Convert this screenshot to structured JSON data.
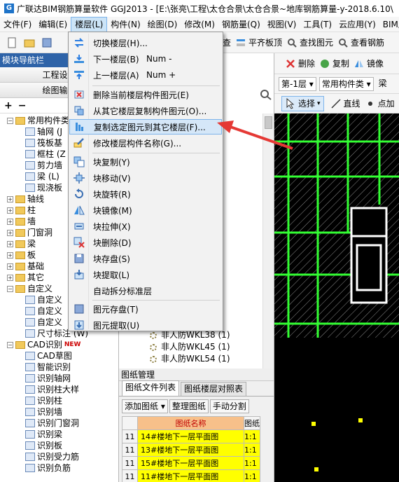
{
  "window": {
    "title": "广联达BIM钢筋算量软件 GGJ2013 - [E:\\张亮\\工程\\太仓合景\\太仓合景~地库钢筋算量-y-2018.6.10\\"
  },
  "menubar": {
    "items": [
      "文件(F)",
      "编辑(E)",
      "楼层(L)",
      "构件(N)",
      "绘图(D)",
      "修改(M)",
      "钢筋量(Q)",
      "视图(V)",
      "工具(T)",
      "云应用(Y)",
      "BIM应"
    ]
  },
  "toolbar": {
    "items": [
      "齐检查",
      "平齐板顶",
      "查找图元",
      "查看钢筋"
    ]
  },
  "leftpanel": {
    "header": "模块导航栏",
    "btn_settings": "工程设置",
    "btn_drawing": "绘图输入",
    "tree": [
      {
        "label": "常用构件类",
        "level": 0,
        "expanded": true
      },
      {
        "label": "轴网 (J",
        "level": 1
      },
      {
        "label": "筏板基",
        "level": 1
      },
      {
        "label": "框柱 (Z",
        "level": 1
      },
      {
        "label": "剪力墙",
        "level": 1
      },
      {
        "label": "梁 (L)",
        "level": 1
      },
      {
        "label": "现浇板",
        "level": 1
      },
      {
        "label": "轴线",
        "level": 0
      },
      {
        "label": "柱",
        "level": 0
      },
      {
        "label": "墙",
        "level": 0
      },
      {
        "label": "门窗洞",
        "level": 0
      },
      {
        "label": "梁",
        "level": 0
      },
      {
        "label": "板",
        "level": 0
      },
      {
        "label": "基础",
        "level": 0
      },
      {
        "label": "其它",
        "level": 0
      },
      {
        "label": "自定义",
        "level": 0,
        "expanded": true
      },
      {
        "label": "自定义",
        "level": 1
      },
      {
        "label": "自定义",
        "level": 1
      },
      {
        "label": "自定义",
        "level": 1
      },
      {
        "label": "尺寸标注 (W)",
        "level": 1
      },
      {
        "label": "CAD识别",
        "level": 0,
        "expanded": true,
        "badge": "NEW"
      },
      {
        "label": "CAD草图",
        "level": 1
      },
      {
        "label": "智能识别",
        "level": 1
      },
      {
        "label": "识别轴网",
        "level": 1
      },
      {
        "label": "识别柱大样",
        "level": 1
      },
      {
        "label": "识别柱",
        "level": 1
      },
      {
        "label": "识别墙",
        "level": 1
      },
      {
        "label": "识别门窗洞",
        "level": 1
      },
      {
        "label": "识别梁",
        "level": 1
      },
      {
        "label": "识别板",
        "level": 1
      },
      {
        "label": "识别受力筋",
        "level": 1
      },
      {
        "label": "识别负筋",
        "level": 1
      }
    ]
  },
  "midpanel": {
    "items": [
      "非人防WKL38 (1)",
      "非人防WKL45 (1)",
      "非人防WKL54 (1)"
    ]
  },
  "drawing_panel": {
    "title": "图纸管理",
    "tabs": [
      "图纸文件列表",
      "图纸楼层对照表"
    ],
    "actions": [
      "添加图纸",
      "整理图纸",
      "手动分割"
    ],
    "col_name": "图纸名称",
    "col_scale": "图纸",
    "rows": [
      {
        "num": "11",
        "name": "14#楼地下一层平面图",
        "scale": "1:1"
      },
      {
        "num": "11",
        "name": "13#楼地下一层平面图",
        "scale": "1:1"
      },
      {
        "num": "11",
        "name": "15#楼地下一层平面图",
        "scale": "1:1"
      },
      {
        "num": "11",
        "name": "11#楼地下一层平面图",
        "scale": "1:1"
      }
    ]
  },
  "right_toolbar": {
    "delete": "删除",
    "copy": "复制",
    "mirror": "镜像",
    "floor": "第-1层",
    "type": "常用构件类",
    "comp": "梁",
    "select": "选择",
    "line": "直线",
    "point": "点加"
  },
  "dropdown": {
    "items": [
      {
        "label": "切换楼层(H)...",
        "shortcut": ""
      },
      {
        "label": "下一楼层(B)",
        "shortcut": "Num -"
      },
      {
        "label": "上一楼层(A)",
        "shortcut": "Num +"
      },
      {
        "label": "删除当前楼层构件图元(E)",
        "shortcut": ""
      },
      {
        "label": "从其它楼层复制构件图元(O)...",
        "shortcut": ""
      },
      {
        "label": "复制选定图元到其它楼层(F)...",
        "shortcut": ""
      },
      {
        "label": "修改楼层构件名称(G)...",
        "shortcut": ""
      },
      {
        "label": "块复制(Y)",
        "shortcut": ""
      },
      {
        "label": "块移动(V)",
        "shortcut": ""
      },
      {
        "label": "块旋转(R)",
        "shortcut": ""
      },
      {
        "label": "块镜像(M)",
        "shortcut": ""
      },
      {
        "label": "块拉伸(X)",
        "shortcut": ""
      },
      {
        "label": "块删除(D)",
        "shortcut": ""
      },
      {
        "label": "块存盘(S)",
        "shortcut": ""
      },
      {
        "label": "块提取(L)",
        "shortcut": ""
      },
      {
        "label": "自动拆分标准层",
        "shortcut": ""
      },
      {
        "label": "图元存盘(T)",
        "shortcut": ""
      },
      {
        "label": "图元提取(U)",
        "shortcut": ""
      }
    ]
  },
  "colors": {
    "menu_highlight": "#d5e7f8",
    "nav_header": "#2e63a8",
    "arrow": "#e53935",
    "canvas_bg": "#000000",
    "beam_green": "#33ff33"
  }
}
